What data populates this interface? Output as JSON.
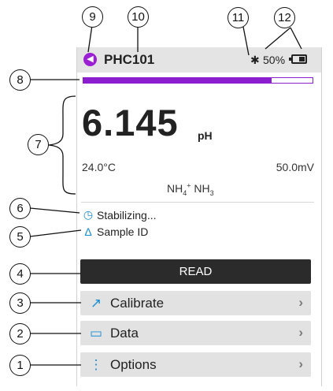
{
  "status_bar": {
    "device_name": "PHC101",
    "battery_percent": "50%",
    "battery_level": 0.5,
    "icons": [
      "back-arrow-icon",
      "bluetooth-icon",
      "battery-icon"
    ]
  },
  "progress": {
    "fraction": 0.82,
    "color": "#8b1fd0"
  },
  "reading": {
    "value": "6.145",
    "unit": "pH",
    "temperature": "24.0°C",
    "millivolts": "50.0mV",
    "ion_a": "NH",
    "ion_a_sub": "4",
    "ion_a_sup": "+",
    "ion_b": "NH",
    "ion_b_sub": "3"
  },
  "status": {
    "stabilizing": "Stabilizing...",
    "sample_id": "Sample ID"
  },
  "buttons": {
    "read": "READ",
    "calibrate": "Calibrate",
    "data": "Data",
    "options": "Options"
  },
  "callouts": [
    "1",
    "2",
    "3",
    "4",
    "5",
    "6",
    "7",
    "8",
    "9",
    "10",
    "11",
    "12"
  ],
  "colors": {
    "accent": "#8b1fd0",
    "icon_blue": "#1b8fd6",
    "read_button": "#2b2b2b"
  }
}
